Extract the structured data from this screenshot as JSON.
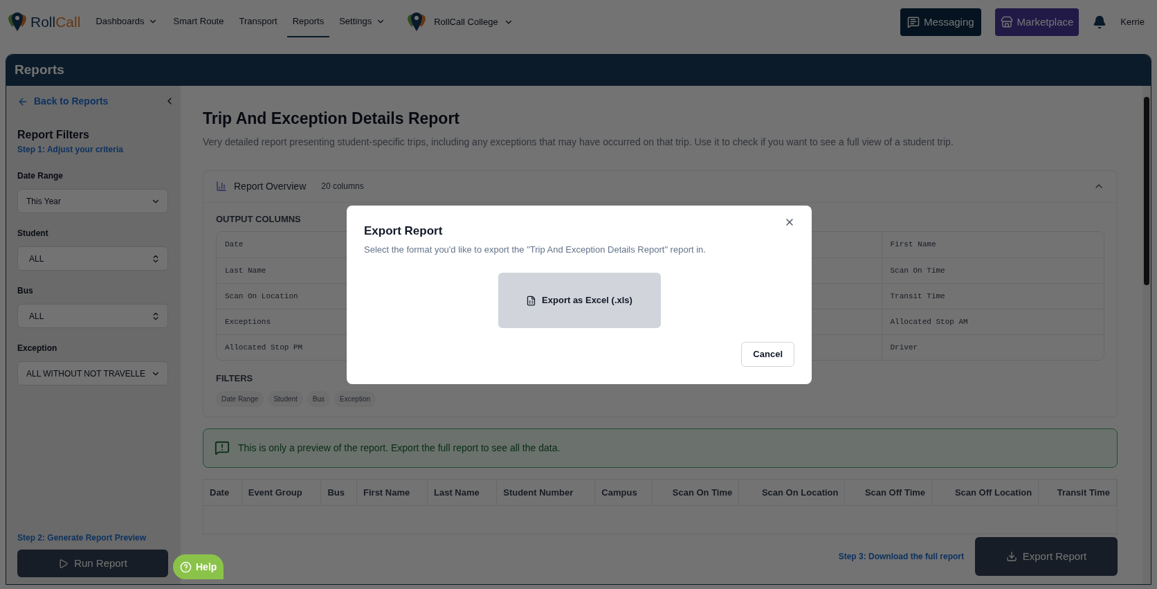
{
  "nav": {
    "brand": [
      "Roll",
      "Call"
    ],
    "items": [
      {
        "label": "Dashboards",
        "dropdown": true,
        "selected": false
      },
      {
        "label": "Smart Route",
        "dropdown": false,
        "selected": false
      },
      {
        "label": "Transport",
        "dropdown": false,
        "selected": false
      },
      {
        "label": "Reports",
        "dropdown": false,
        "selected": true
      },
      {
        "label": "Settings",
        "dropdown": true,
        "selected": false
      }
    ],
    "school": "RollCall College",
    "messaging": "Messaging",
    "marketplace": "Marketplace",
    "user": "Kerrie"
  },
  "page_header": {
    "title": "Reports"
  },
  "sidebar": {
    "back_link": "Back to Reports",
    "title": "Report Filters",
    "step1": "Step 1: Adjust your criteria",
    "filters": [
      {
        "label": "Date Range",
        "value": "This Year",
        "kind": "select"
      },
      {
        "label": "Student",
        "value": "ALL",
        "kind": "combobox"
      },
      {
        "label": "Bus",
        "value": "ALL",
        "kind": "combobox"
      },
      {
        "label": "Exception",
        "value": "ALL WITHOUT NOT TRAVELLE",
        "kind": "select"
      }
    ],
    "step2": "Step 2: Generate Report Preview",
    "run_button": "Run Report"
  },
  "report": {
    "title": "Trip And Exception Details Report",
    "description": "Very detailed report presenting student-specific trips, including any exceptions that may have occurred on that trip. Use it to check if you want to see a full view of a student trip.",
    "overview": {
      "title": "Report Overview",
      "count": "20 columns",
      "expanded": true,
      "output_columns_heading": "OUTPUT COLUMNS",
      "column_1": [
        "Date",
        "Last Name",
        "Scan On Location",
        "Exceptions",
        "Allocated Stop PM"
      ],
      "column_4": [
        "First Name",
        "Scan On Time",
        "Transit Time",
        "Allocated Stop AM",
        "Driver"
      ],
      "filters_heading": "FILTERS",
      "filter_tags": [
        "Date Range",
        "Student",
        "Bus",
        "Exception"
      ]
    },
    "preview_note": "This is only a preview of the report. Export the full report to see all the data.",
    "table": {
      "columns": [
        "Date",
        "Event Group",
        "Bus",
        "First Name",
        "Last Name",
        "Student Number",
        "Campus",
        "Scan On Time",
        "Scan On Location",
        "Scan Off Time",
        "Scan Off Location",
        "Transit Time"
      ]
    },
    "step3": "Step 3: Download the full report",
    "export_button": "Export Report"
  },
  "help_button": "Help",
  "dialog": {
    "title": "Export Report",
    "description": "Select the format you'd like to export the \"Trip And Exception Details Report\" report in.",
    "options": [
      "Export as Excel (.xls)"
    ],
    "cancel": "Cancel"
  }
}
